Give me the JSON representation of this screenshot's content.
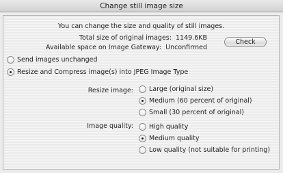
{
  "window": {
    "title": "Change still image size"
  },
  "intro": "You can change the size and quality of still images.",
  "info": {
    "total_size_label": "Total size of original images:",
    "total_size_value": "1149.6KB",
    "space_label": "Available space on Image Gateway:",
    "space_value": "Unconfirmed"
  },
  "check_button": "Check",
  "mode_options": [
    {
      "label": "Send images unchanged",
      "selected": false
    },
    {
      "label": "Resize and Compress image(s) into JPEG Image Type",
      "selected": true
    }
  ],
  "resize": {
    "label": "Resize image:",
    "options": [
      {
        "label": "Large (original size)",
        "selected": false
      },
      {
        "label": "Medium (60 percent of original)",
        "selected": true
      },
      {
        "label": "Small (30 percent of original)",
        "selected": false
      }
    ]
  },
  "quality": {
    "label": "Image quality:",
    "options": [
      {
        "label": "High quality",
        "selected": false
      },
      {
        "label": "Medium quality",
        "selected": true
      },
      {
        "label": "Low quality (not suitable for printing)",
        "selected": false
      }
    ]
  }
}
